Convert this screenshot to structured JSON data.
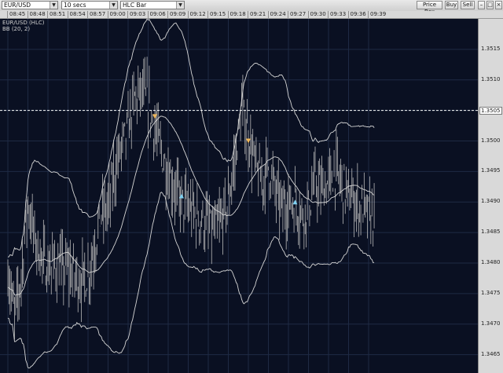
{
  "toolbar": {
    "symbol": "EUR/USD",
    "interval": "10 secs",
    "chart_style": "HLC Bar",
    "price_box_label": "Price Box",
    "buy_label": "Buy",
    "sell_label": "Sell"
  },
  "legend": {
    "main": "EUR/USD (HLC)",
    "indicator": "BB (20, 2)"
  },
  "time_axis": [
    "08:45",
    "08:48",
    "08:51",
    "08:54",
    "08:57",
    "09:00",
    "09:03",
    "09:06",
    "09:09",
    "09:12",
    "09:15",
    "09:18",
    "09:21",
    "09:24",
    "09:27",
    "09:30",
    "09:33",
    "09:36",
    "09:39"
  ],
  "price_axis": [
    "1.3515",
    "1.3510",
    "1.3505",
    "1.3500",
    "1.3495",
    "1.3490",
    "1.3485",
    "1.3480",
    "1.3475",
    "1.3470",
    "1.3465"
  ],
  "highlighted_price": "1.3505",
  "colors": {
    "background": "#0a1022",
    "grid": "#1f2a44",
    "bars": "#b8b8b8",
    "bands": "#d5d5d5",
    "sell_marker": "#f0b85a",
    "buy_marker": "#7fd0f0",
    "price_line": "#ffffff"
  },
  "chart_data": {
    "type": "line",
    "series": [
      {
        "name": "EUR/USD (HLC)",
        "values": [
          {
            "t": "08:45",
            "close": 1.3479
          },
          {
            "t": "08:46",
            "close": 1.3471
          },
          {
            "t": "08:47",
            "close": 1.3478
          },
          {
            "t": "08:48",
            "close": 1.349
          },
          {
            "t": "08:49",
            "close": 1.3484
          },
          {
            "t": "08:50",
            "close": 1.3481
          },
          {
            "t": "08:51",
            "close": 1.3479
          },
          {
            "t": "08:52",
            "close": 1.348
          },
          {
            "t": "08:53",
            "close": 1.3479
          },
          {
            "t": "08:54",
            "close": 1.3479
          },
          {
            "t": "08:55",
            "close": 1.3478
          },
          {
            "t": "08:56",
            "close": 1.3477
          },
          {
            "t": "08:57",
            "close": 1.3478
          },
          {
            "t": "08:58",
            "close": 1.3483
          },
          {
            "t": "08:59",
            "close": 1.3488
          },
          {
            "t": "09:00",
            "close": 1.3489
          },
          {
            "t": "09:01",
            "close": 1.3495
          },
          {
            "t": "09:02",
            "close": 1.3499
          },
          {
            "t": "09:03",
            "close": 1.3502
          },
          {
            "t": "09:04",
            "close": 1.3507
          },
          {
            "t": "09:05",
            "close": 1.3508
          },
          {
            "t": "09:06",
            "close": 1.3506
          },
          {
            "t": "09:07",
            "close": 1.3502
          },
          {
            "t": "09:08",
            "close": 1.3498
          },
          {
            "t": "09:09",
            "close": 1.3495
          },
          {
            "t": "09:10",
            "close": 1.3492
          },
          {
            "t": "09:11",
            "close": 1.349
          },
          {
            "t": "09:12",
            "close": 1.3489
          },
          {
            "t": "09:13",
            "close": 1.3488
          },
          {
            "t": "09:14",
            "close": 1.3487
          },
          {
            "t": "09:15",
            "close": 1.3486
          },
          {
            "t": "09:16",
            "close": 1.3485
          },
          {
            "t": "09:17",
            "close": 1.3487
          },
          {
            "t": "09:18",
            "close": 1.349
          },
          {
            "t": "09:19",
            "close": 1.3497
          },
          {
            "t": "09:20",
            "close": 1.3505
          },
          {
            "t": "09:21",
            "close": 1.3501
          },
          {
            "t": "09:22",
            "close": 1.3496
          },
          {
            "t": "09:23",
            "close": 1.3493
          },
          {
            "t": "09:24",
            "close": 1.3496
          },
          {
            "t": "09:25",
            "close": 1.3492
          },
          {
            "t": "09:26",
            "close": 1.3489
          },
          {
            "t": "09:27",
            "close": 1.349
          },
          {
            "t": "09:28",
            "close": 1.349
          },
          {
            "t": "09:29",
            "close": 1.3488
          },
          {
            "t": "09:30",
            "close": 1.3489
          },
          {
            "t": "09:31",
            "close": 1.3493
          },
          {
            "t": "09:32",
            "close": 1.3492
          },
          {
            "t": "09:33",
            "close": 1.3493
          },
          {
            "t": "09:34",
            "close": 1.3495
          },
          {
            "t": "09:35",
            "close": 1.3493
          },
          {
            "t": "09:36",
            "close": 1.3491
          },
          {
            "t": "09:37",
            "close": 1.349
          },
          {
            "t": "09:38",
            "close": 1.3489
          },
          {
            "t": "09:39",
            "close": 1.3488
          },
          {
            "t": "09:40",
            "close": 1.3487
          }
        ]
      }
    ],
    "ylim": [
      1.3462,
      1.352
    ],
    "grid": true,
    "markers": [
      {
        "t": "09:07",
        "price": 1.3504,
        "kind": "sell"
      },
      {
        "t": "09:11",
        "price": 1.3491,
        "kind": "buy"
      },
      {
        "t": "09:21",
        "price": 1.35,
        "kind": "sell"
      },
      {
        "t": "09:28",
        "price": 1.349,
        "kind": "buy"
      }
    ]
  }
}
